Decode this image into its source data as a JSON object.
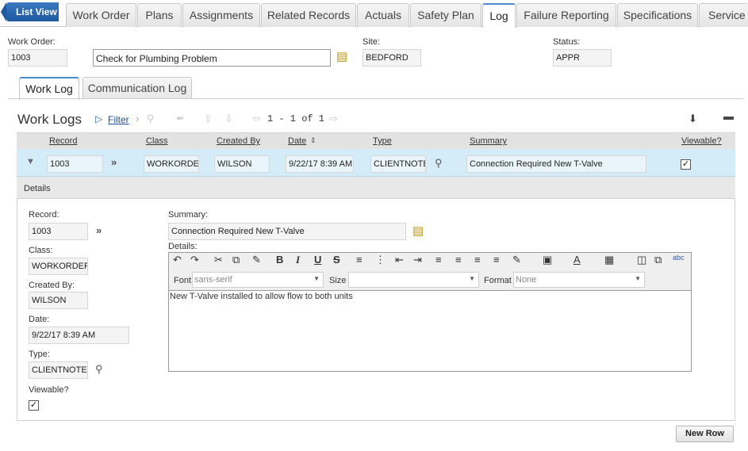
{
  "top_tabs": {
    "list_view": "List View",
    "tabs": [
      "Work Order",
      "Plans",
      "Assignments",
      "Related Records",
      "Actuals",
      "Safety Plan",
      "Log",
      "Failure Reporting",
      "Specifications",
      "Service A"
    ],
    "active": "Log"
  },
  "header": {
    "work_order_label": "Work Order:",
    "work_order": "1003",
    "description": "Check for Plumbing Problem",
    "site_label": "Site:",
    "site": "BEDFORD",
    "status_label": "Status:",
    "status": "APPR"
  },
  "sub_tabs": [
    "Work Log",
    "Communication Log"
  ],
  "worklogs": {
    "title": "Work Logs",
    "filter": "Filter",
    "pagination": "1 - 1 of 1",
    "columns": [
      "Record",
      "Class",
      "Created By",
      "Date",
      "Type",
      "Summary",
      "Viewable?"
    ],
    "row": {
      "record": "1003",
      "class": "WORKORDE",
      "created_by": "WILSON",
      "date": "9/22/17 8:39 AM",
      "type": "CLIENTNOTE",
      "summary": "Connection Required New T-Valve",
      "viewable": true
    }
  },
  "details": {
    "bar_label": "Details",
    "record_label": "Record:",
    "record": "1003",
    "class_label": "Class:",
    "class": "WORKORDER",
    "created_by_label": "Created By:",
    "created_by": "WILSON",
    "date_label": "Date:",
    "date": "9/22/17 8:39 AM",
    "type_label": "Type:",
    "type": "CLIENTNOTE",
    "viewable_label": "Viewable?",
    "summary_label": "Summary:",
    "summary": "Connection Required New T-Valve",
    "details_label": "Details:",
    "font_label": "Font",
    "font_value": "sans-serif",
    "size_label": "Size",
    "size_value": "",
    "format_label": "Format",
    "format_value": "None",
    "body_text": "New T-Valve installed to allow flow to both units"
  },
  "new_row": "New Row"
}
